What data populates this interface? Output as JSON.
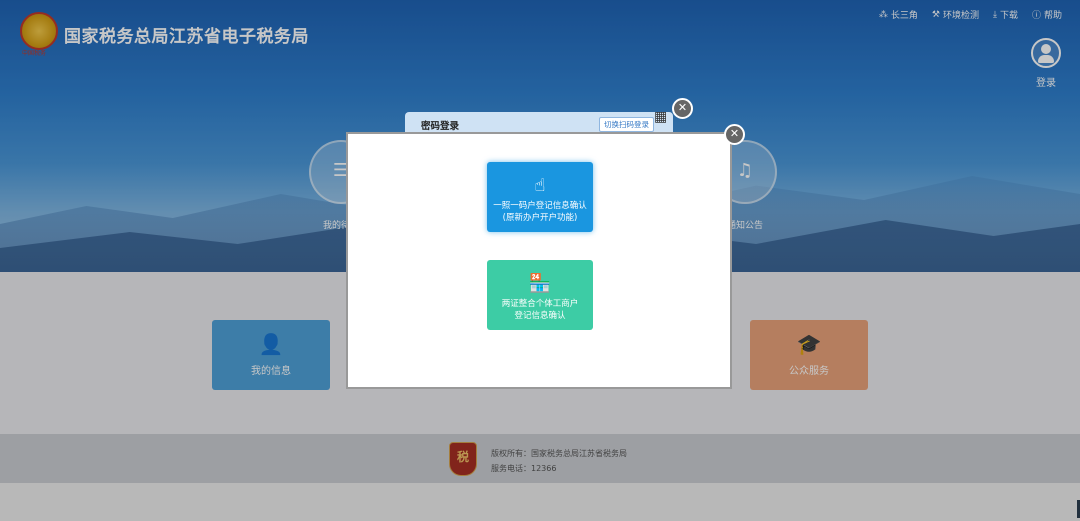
{
  "header": {
    "title": "国家税务总局江苏省电子税务局",
    "logo_sub": "中国税务",
    "nav": [
      {
        "icon": "network-icon",
        "label": "长三角"
      },
      {
        "icon": "tools-icon",
        "label": "环境检测"
      },
      {
        "icon": "download-icon",
        "label": "下载"
      },
      {
        "icon": "help-icon",
        "label": "帮助"
      }
    ],
    "login_label": "登录"
  },
  "banner_items": [
    {
      "label": "我的待办",
      "icon": "list-icon"
    },
    {
      "label": "通知公告",
      "icon": "bell-icon"
    }
  ],
  "tiles": [
    {
      "label": "我的信息",
      "icon": "user-icon",
      "color": "#4fa0d8"
    },
    {
      "label": "公众服务",
      "icon": "graduation-icon",
      "color": "#e8a27a"
    }
  ],
  "login_panel": {
    "title": "密码登录",
    "switch_label": "切换扫码登录"
  },
  "modal": {
    "options": [
      {
        "icon": "tap-icon",
        "line1": "一照一码户登记信息确认",
        "line2": "(原新办户开户功能)",
        "color": "#1a96e0"
      },
      {
        "icon": "store-icon",
        "line1": "两证整合个体工商户",
        "line2": "登记信息确认",
        "color": "#3dcca5"
      }
    ]
  },
  "footer": {
    "badge": "税",
    "copyright": "版权所有：国家税务总局江苏省税务局",
    "phone": "服务电话：12366"
  }
}
